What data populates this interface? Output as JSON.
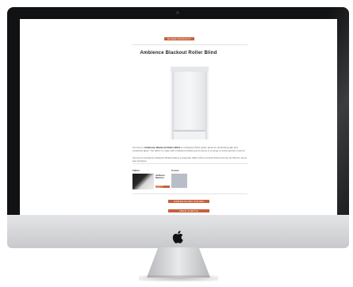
{
  "page": {
    "top_button": "Share product",
    "title": "Ambience Blackout Roller Blind",
    "description_1_prefix": "Ourmoor's",
    "description_1_bold": "Ambience Blackout Roller Blind",
    "description_1_rest": "is a blackout blind option ideal for eliminating light and unwanted glare. The fabric is made with a blackout backing and comes in a range of contemporary colours.",
    "description_2": "Ourmoor's Ambience blackout blinds feature a polyester fabric with a smooth finish and can be fitted to doors and windows.",
    "fabric_label": "Fabric",
    "colour_label": "Colour",
    "fabric_name": "Ambience Blackout",
    "fabric_button": "Change fabric",
    "cta_primary": "Order blind online",
    "cta_secondary": "Free sample"
  },
  "colors": {
    "accent": "#c8603a",
    "bezel": "#111214",
    "chin": "#d6d7da",
    "screen_bg": "#ffffff"
  },
  "icons": {
    "brand": "apple-logo-icon"
  }
}
